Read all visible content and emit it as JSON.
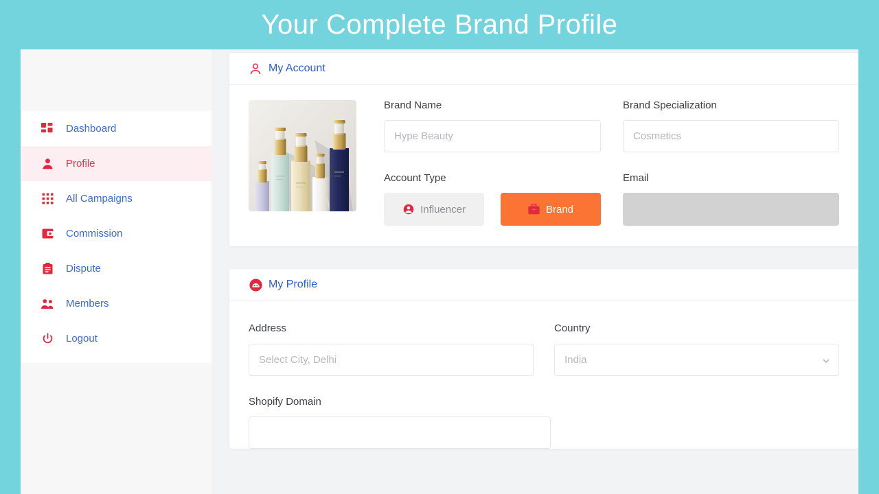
{
  "banner": {
    "title": "Your Complete Brand Profile"
  },
  "colors": {
    "background_teal": "#74d4dd",
    "accent_red": "#e02841",
    "link_blue": "#3a6ad0",
    "active_orange": "#fc7434",
    "active_nav_bg": "#fdeef1",
    "disabled_gray": "#d2d2d2"
  },
  "sidebar": {
    "items": [
      {
        "label": "Dashboard",
        "icon": "dashboard-icon",
        "active": false
      },
      {
        "label": "Profile",
        "icon": "person-icon",
        "active": true
      },
      {
        "label": "All Campaigns",
        "icon": "grid-dots-icon",
        "active": false
      },
      {
        "label": "Commission",
        "icon": "wallet-icon",
        "active": false
      },
      {
        "label": "Dispute",
        "icon": "clipboard-icon",
        "active": false
      },
      {
        "label": "Members",
        "icon": "people-icon",
        "active": false
      },
      {
        "label": "Logout",
        "icon": "power-icon",
        "active": false
      }
    ]
  },
  "account_card": {
    "header": {
      "title": "My Account",
      "icon": "person-outline-icon"
    },
    "avatar": {
      "alt": "brand product cosmetic serum bottles"
    },
    "brand_name": {
      "label": "Brand Name",
      "value": "",
      "placeholder": "Hype Beauty"
    },
    "brand_specialization": {
      "label": "Brand Specialization",
      "value": "",
      "placeholder": "Cosmetics"
    },
    "account_type": {
      "label": "Account Type",
      "options": [
        {
          "label": "Influencer",
          "icon": "user-circle-icon",
          "selected": false
        },
        {
          "label": "Brand",
          "icon": "briefcase-icon",
          "selected": true
        }
      ]
    },
    "email": {
      "label": "Email",
      "value": "",
      "disabled": true
    }
  },
  "profile_card": {
    "header": {
      "title": "My Profile",
      "icon": "face-icon"
    },
    "address": {
      "label": "Address",
      "value": "",
      "placeholder": "Select City, Delhi"
    },
    "country": {
      "label": "Country",
      "value": "",
      "placeholder": "India",
      "icon": "chevron-down-icon"
    },
    "shopify_domain": {
      "label": "Shopify Domain",
      "value": "",
      "placeholder": ""
    }
  }
}
